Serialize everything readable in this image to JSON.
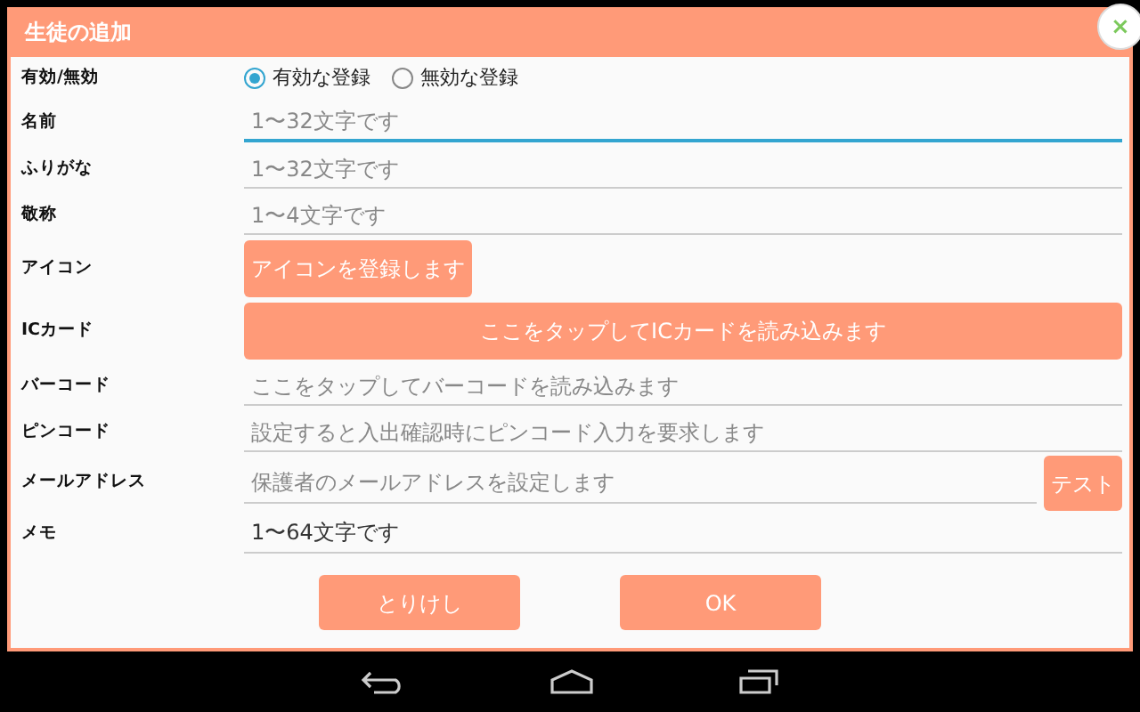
{
  "dialog": {
    "title": "生徒の追加",
    "close": "×"
  },
  "rows": [
    {
      "kind": "radio",
      "label": "有効/無効",
      "options": [
        {
          "label": "有効な登録",
          "selected": true
        },
        {
          "label": "無効な登録",
          "selected": false
        }
      ]
    },
    {
      "kind": "text",
      "label": "名前",
      "placeholder": "1〜32文字です",
      "focused": true
    },
    {
      "kind": "text",
      "label": "ふりがな",
      "placeholder": "1〜32文字です",
      "focused": false
    },
    {
      "kind": "text",
      "label": "敬称",
      "placeholder": "1〜4文字です",
      "focused": false
    },
    {
      "kind": "button",
      "label": "アイコン",
      "button": "アイコンを登録します"
    },
    {
      "kind": "wide_button",
      "label": "ICカード",
      "button": "ここをタップしてICカードを読み込みます"
    },
    {
      "kind": "text",
      "label": "バーコード",
      "placeholder": "ここをタップしてバーコードを読み込みます",
      "focused": false
    },
    {
      "kind": "text",
      "label": "ピンコード",
      "placeholder": "設定すると入出確認時にピンコード入力を要求します",
      "focused": false
    },
    {
      "kind": "text_button",
      "label": "メールアドレス",
      "placeholder": "保護者のメールアドレスを設定します",
      "button": "テスト",
      "focused": false
    },
    {
      "kind": "text",
      "label": "メモ",
      "value": "1〜64文字です",
      "focused": false
    }
  ],
  "actions": [
    "とりけし",
    "OK"
  ]
}
